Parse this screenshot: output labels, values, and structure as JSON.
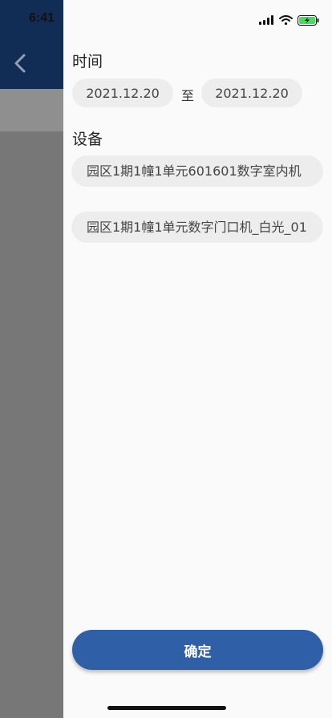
{
  "status_bar": {
    "time": "6:41",
    "signal_icon": "cellular-signal-icon",
    "wifi_icon": "wifi-icon",
    "battery_icon": "battery-charging-icon"
  },
  "background_page": {
    "back_icon": "chevron-left-icon",
    "header_color": "#122d55"
  },
  "filter_drawer": {
    "time_section": {
      "title": "时间",
      "start_date": "2021.12.20",
      "separator": "至",
      "end_date": "2021.12.20"
    },
    "device_section": {
      "title": "设备",
      "devices": [
        {
          "name": "园区1期1幢1单元601601数字室内机"
        },
        {
          "name": "园区1期1幢1单元数字门口机_白光_01"
        }
      ]
    },
    "confirm_label": "确定",
    "accent_color": "#2f5fa6"
  }
}
